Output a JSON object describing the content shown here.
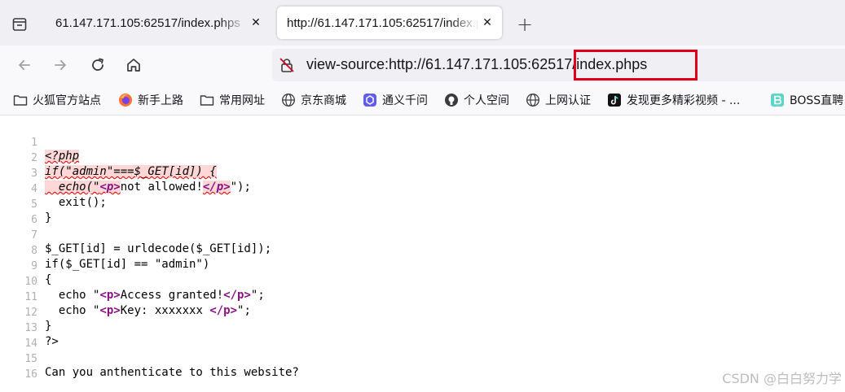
{
  "tabs": [
    {
      "title": "61.147.171.105:62517/index.phps",
      "active": false
    },
    {
      "title": "http://61.147.171.105:62517/index.phps",
      "active": true
    }
  ],
  "new_tab_symbol": "+",
  "close_symbol": "✕",
  "url": {
    "prefix": "view-source:http://61.147.171.105:6251",
    "highlighted": "7/index.phps",
    "highlight_color": "#e0001b"
  },
  "bookmarks": [
    {
      "label": "火狐官方站点",
      "icon": "folder-icon"
    },
    {
      "label": "新手上路",
      "icon": "firefox-icon"
    },
    {
      "label": "常用网址",
      "icon": "folder-icon"
    },
    {
      "label": "京东商城",
      "icon": "globe-icon"
    },
    {
      "label": "通义千问",
      "icon": "tongyi-icon"
    },
    {
      "label": "个人空间",
      "icon": "github-icon"
    },
    {
      "label": "上网认证",
      "icon": "globe-icon"
    },
    {
      "label": "发现更多精彩视频 - ...",
      "icon": "tiktok-icon"
    },
    {
      "label": "BOSS直聘",
      "icon": "boss-icon"
    }
  ],
  "source_lines": [
    {
      "n": "1"
    },
    {
      "n": "2"
    },
    {
      "n": "3"
    },
    {
      "n": "4",
      "text": "  exit();"
    },
    {
      "n": "5",
      "text": "}"
    },
    {
      "n": "6",
      "text": ""
    },
    {
      "n": "7",
      "text": "$_GET[id] = urldecode($_GET[id]);"
    },
    {
      "n": "8",
      "text": "if($_GET[id] == \"admin\")"
    },
    {
      "n": "9",
      "text": "{"
    },
    {
      "n": "10"
    },
    {
      "n": "11"
    },
    {
      "n": "12",
      "text": "}"
    },
    {
      "n": "13",
      "text": "?>"
    },
    {
      "n": "14",
      "text": ""
    },
    {
      "n": "15",
      "text": "Can you anthenticate to this website?"
    },
    {
      "n": "16",
      "text": ""
    }
  ],
  "code": {
    "l1": "<?php",
    "l2": "if(\"admin\"===$_GET[id]) {",
    "l3_a": "  echo(\"",
    "l3_tag_open": "<p>",
    "l3_b": "not allowed!",
    "l3_tag_close": "</p>",
    "l3_c": "\");",
    "l10_a": "  echo \"",
    "l10_tag_open": "<p>",
    "l10_b": "Access granted!",
    "l10_tag_close": "</p>",
    "l10_c": "\";",
    "l11_a": "  echo \"",
    "l11_tag_open": "<p>",
    "l11_b": "Key: xxxxxxx ",
    "l11_tag_close": "</p>",
    "l11_c": "\";"
  },
  "watermark": "CSDN @白白努力学",
  "colors": {
    "tag": "#881280",
    "error_bg": "#ffd7d7",
    "line_number": "#b0b0b0"
  }
}
